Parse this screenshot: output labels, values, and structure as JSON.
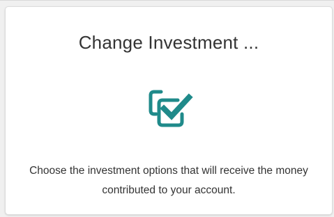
{
  "card": {
    "title": "Change Investment ...",
    "icon": "document-checkmark-icon",
    "description": "Choose the investment options that will receive the money contributed to your account."
  },
  "colors": {
    "icon_teal": "#1f8a8a",
    "text": "#333333",
    "card_border": "#dcdcdc",
    "background": "#f0f0f0"
  }
}
